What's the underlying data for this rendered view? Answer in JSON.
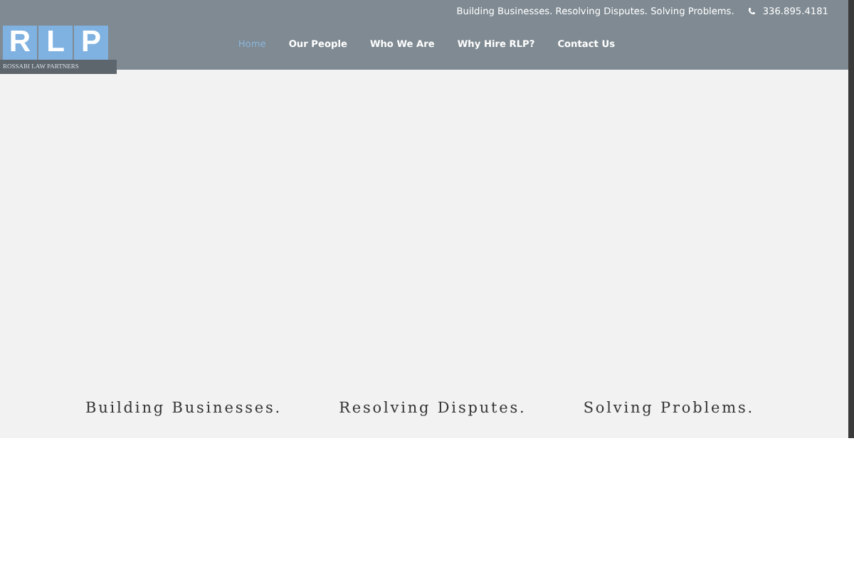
{
  "topbar": {
    "tagline": "Building Businesses. Resolving Disputes. Solving Problems.",
    "phone": "336.895.4181"
  },
  "logo": {
    "letters": [
      "R",
      "L",
      "P"
    ],
    "subtitle": "ROSSABI LAW PARTNERS"
  },
  "nav": [
    {
      "label": "Home",
      "selected": true
    },
    {
      "label": "Our People",
      "selected": false
    },
    {
      "label": "Who We Are",
      "selected": false
    },
    {
      "label": "Why Hire RLP?",
      "selected": false
    },
    {
      "label": "Contact Us",
      "selected": false
    }
  ],
  "hero": {
    "slogans": [
      "Building Businesses.",
      "Resolving Disputes.",
      "Solving Problems."
    ]
  }
}
